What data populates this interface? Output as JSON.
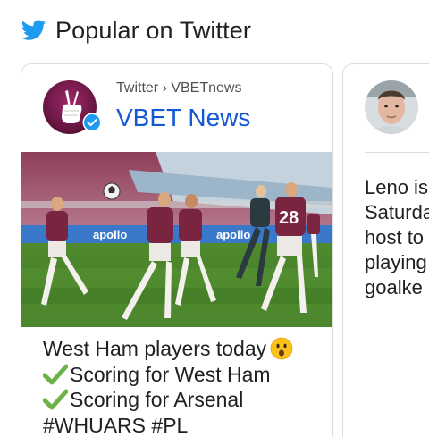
{
  "header": {
    "title": "Popular on Twitter",
    "icon": "twitter-bird-icon",
    "brand_color": "#1d9bf0"
  },
  "cards": [
    {
      "source": "Twitter › VBETnews",
      "author_name": "VBET News",
      "verified": true,
      "author_color": "#1558d6",
      "image_alt": "West Ham players in action on the pitch",
      "jersey_number": "28",
      "text_lines": [
        "West Ham players today",
        "Scoring for West Ham",
        "Scoring for Arsenal",
        "#WHUARS #PL"
      ]
    },
    {
      "text_lines": [
        "Leno is",
        "Saturda",
        "host to",
        "playing",
        "goalke"
      ]
    }
  ]
}
